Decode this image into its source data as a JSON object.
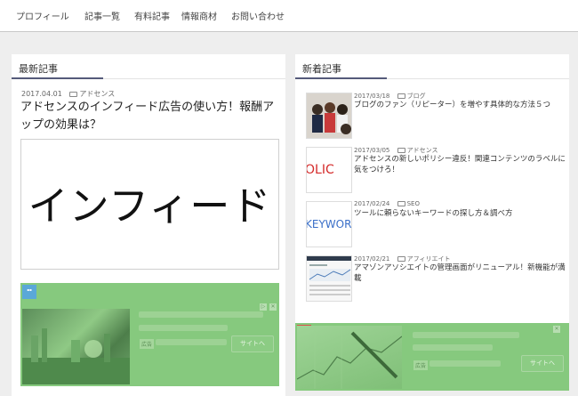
{
  "nav": {
    "items": [
      "プロフィール",
      "記事一覧",
      "有料記事",
      "情報商材",
      "お問い合わせ"
    ]
  },
  "latest": {
    "heading": "最新記事",
    "date": "2017.04.01",
    "category": "アドセンス",
    "title": "アドセンスのインフィード広告の使い方！報酬アップの効果は？",
    "image_text": "インフィード",
    "ad": {
      "button": "サイトへ",
      "tag": "広告"
    }
  },
  "new_posts": {
    "heading": "新着記事",
    "items": [
      {
        "date": "2017/03/18",
        "category": "ブログ",
        "title": "ブログのファン（リピーター）を増やす具体的な方法５つ",
        "thumb": "people-photo"
      },
      {
        "date": "2017/03/05",
        "category": "アドセンス",
        "title": "アドセンスの新しいポリシー違反！関連コンテンツのラベルに気をつけろ！",
        "thumb_text": "OLIC"
      },
      {
        "date": "2017/02/24",
        "category": "SEO",
        "title": "ツールに頼らないキーワードの探し方＆調べ方",
        "thumb_text": "KEYWORI"
      },
      {
        "date": "2017/02/21",
        "category": "アフィリエイト",
        "title": "アマゾンアソシエイトの管理画面がリニューアル！新機能が満載",
        "thumb": "dashboard-screenshot"
      }
    ],
    "ad": {
      "button": "サイトへ",
      "tag": "広告"
    }
  },
  "colors": {
    "ad_overlay": "#86c97e",
    "accent_underline": "#555a7a",
    "policy_red": "#d42a2a",
    "keyword_blue": "#3a6fc8"
  }
}
